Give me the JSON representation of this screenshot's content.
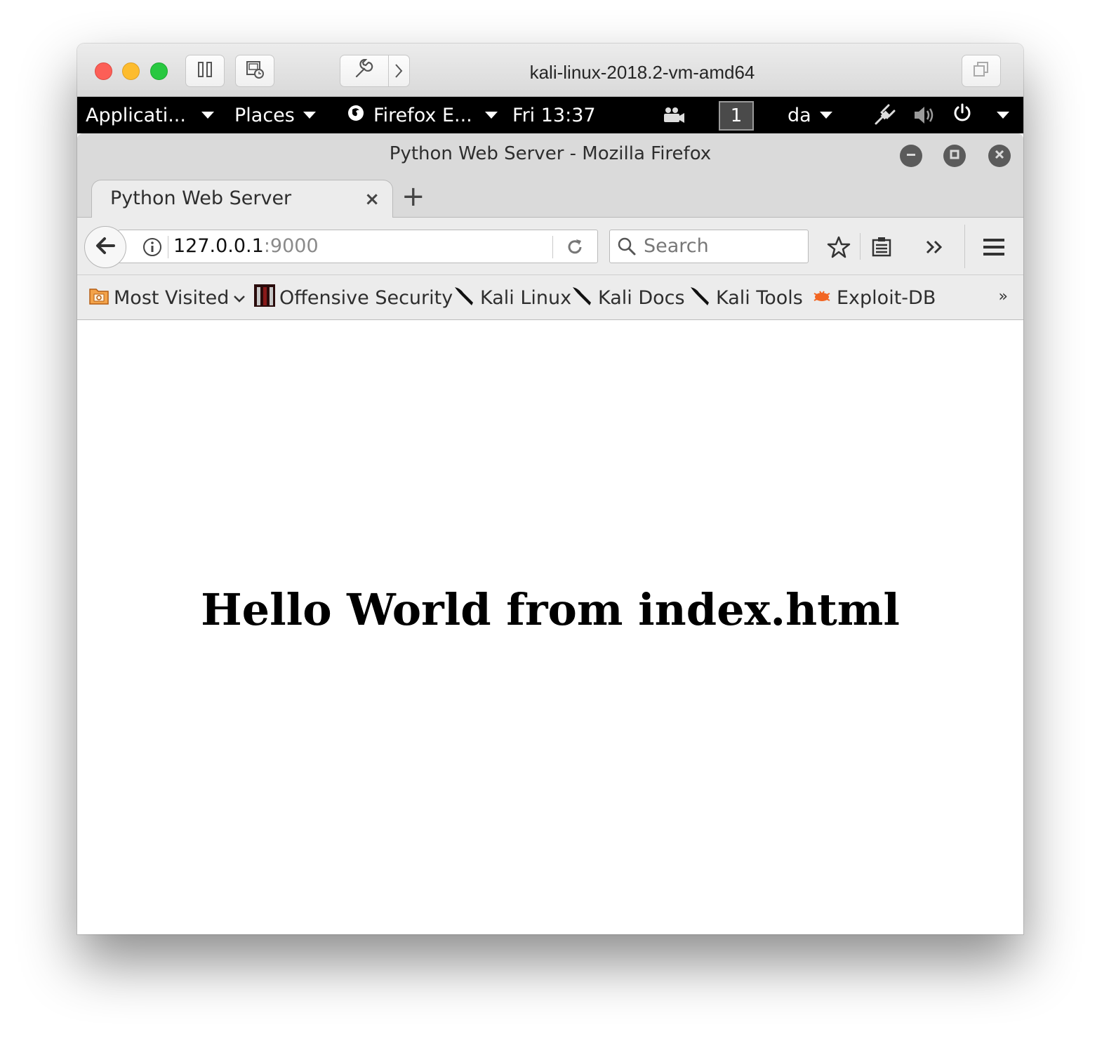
{
  "vm": {
    "title": "kali-linux-2018.2-vm-amd64",
    "buttons": [
      "pause-icon",
      "snapshot-icon",
      "settings-wrench-icon",
      "chevron-right-icon",
      "window-restore-icon"
    ]
  },
  "gnome": {
    "applications": "Applicati...",
    "places": "Places",
    "app_menu": "Firefox E...",
    "clock": "Fri 13:37",
    "workspace": "1",
    "keyboard": "da"
  },
  "firefox": {
    "window_title": "Python Web Server - Mozilla Firefox",
    "tab_label": "Python Web Server",
    "tab_close": "×",
    "new_tab": "+",
    "url_host": "127.0.0.1",
    "url_port": ":9000",
    "search_placeholder": "Search",
    "bookmarks": {
      "most_visited": "Most Visited",
      "items": [
        "Offensive Security",
        "Kali Linux",
        "Kali Docs",
        "Kali Tools",
        "Exploit-DB"
      ],
      "overflow": "»"
    }
  },
  "page": {
    "heading": "Hello World from index.html"
  }
}
